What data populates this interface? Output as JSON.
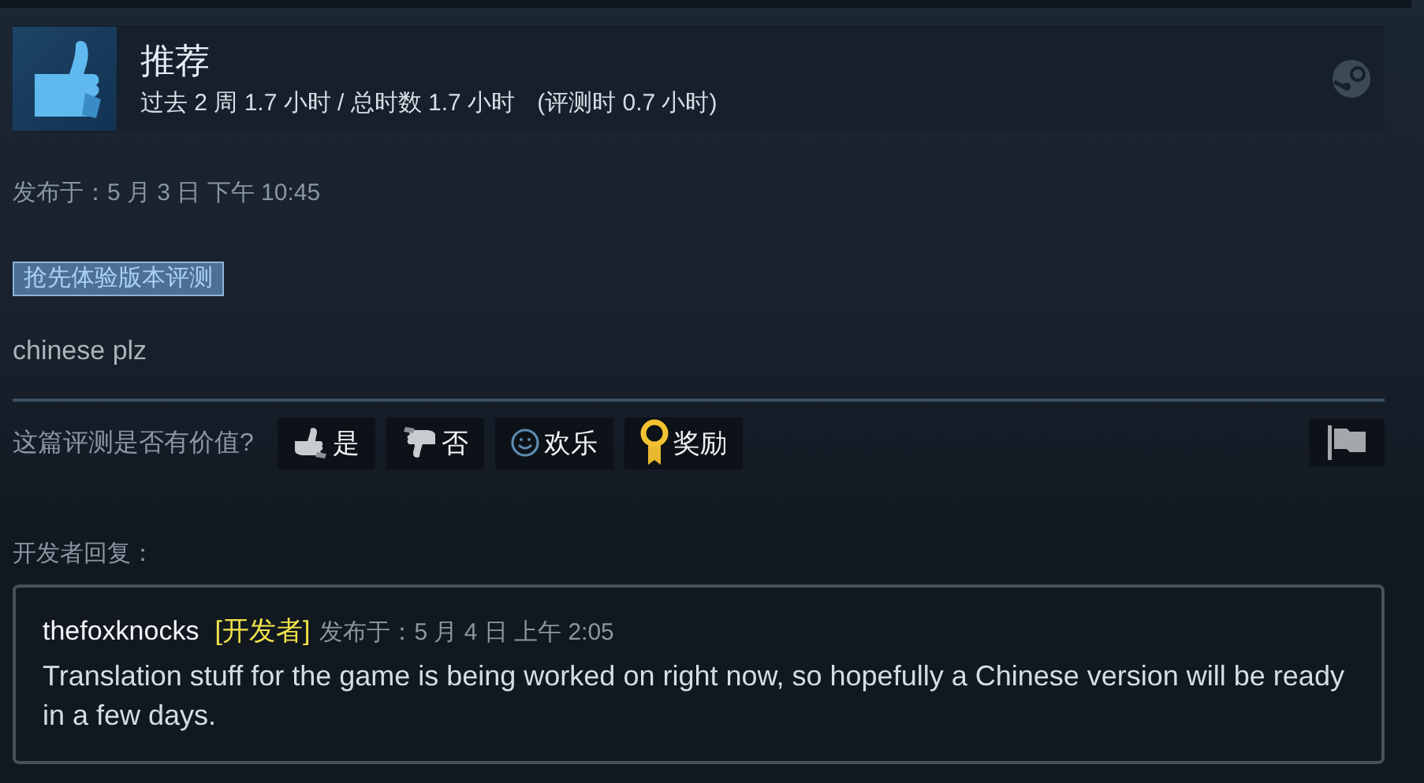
{
  "review": {
    "verdict": "推荐",
    "recommended": true,
    "hours": "过去 2 周 1.7 小时 / 总时数 1.7 小时",
    "review_hours": "(评测时 0.7 小时)"
  },
  "posted": "发布于：5 月 3 日 下午 10:45",
  "tag": "抢先体验版本评测",
  "body": "chinese plz",
  "helpful": {
    "question": "这篇评测是否有价值?",
    "buttons": [
      {
        "kind": "yes",
        "label": "是"
      },
      {
        "kind": "no",
        "label": "否"
      },
      {
        "kind": "funny",
        "label": "欢乐"
      },
      {
        "kind": "award",
        "label": "奖励"
      }
    ]
  },
  "developer_response": {
    "heading": "开发者回复：",
    "author": "thefoxknocks",
    "badge": "[开发者]",
    "posted": "发布于：5 月 4 日 上午 2:05",
    "text": "Translation stuff for the game is being worked on right now, so hopefully a Chinese version will be ready in a few days."
  }
}
